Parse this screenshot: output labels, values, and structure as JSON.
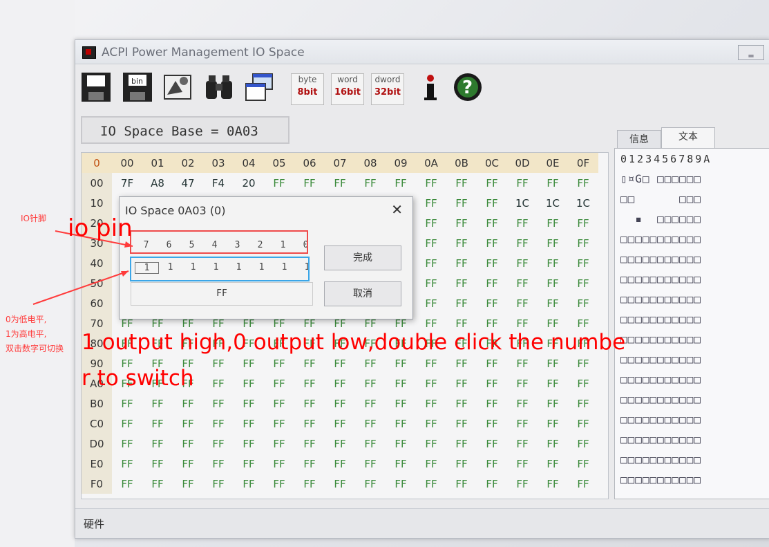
{
  "window": {
    "title": "ACPI Power Management IO Space",
    "minimize_glyph": "‗"
  },
  "toolbar": {
    "buttons": [
      {
        "name": "save-icon"
      },
      {
        "name": "save-bin-icon",
        "label": "bin"
      },
      {
        "name": "browse-icon"
      },
      {
        "name": "binoculars-icon"
      },
      {
        "name": "windows-icon"
      },
      {
        "name": "byte",
        "t1": "byte",
        "t2": "8bit"
      },
      {
        "name": "word",
        "t1": "word",
        "t2": "16bit"
      },
      {
        "name": "dword",
        "t1": "dword",
        "t2": "32bit"
      },
      {
        "name": "info-icon"
      },
      {
        "name": "help-icon"
      }
    ]
  },
  "io_base": "IO Space Base = 0A03",
  "grid": {
    "corner": "0",
    "columns": [
      "00",
      "01",
      "02",
      "03",
      "04",
      "05",
      "06",
      "07",
      "08",
      "09",
      "0A",
      "0B",
      "0C",
      "0D",
      "0E",
      "0F"
    ],
    "rows": [
      {
        "h": "00",
        "v": [
          "7F",
          "A8",
          "47",
          "F4",
          "20",
          "FF",
          "FF",
          "FF",
          "FF",
          "FF",
          "FF",
          "FF",
          "FF",
          "FF",
          "FF",
          "FF"
        ]
      },
      {
        "h": "10",
        "v": [
          "",
          "",
          "",
          "",
          "",
          "",
          "",
          "",
          "",
          "",
          "FF",
          "FF",
          "FF",
          "1C",
          "1C",
          "1C"
        ]
      },
      {
        "h": "20",
        "v": [
          "",
          "",
          "",
          "",
          "",
          "",
          "",
          "",
          "",
          "",
          "FF",
          "FF",
          "FF",
          "FF",
          "FF",
          "FF"
        ]
      },
      {
        "h": "30",
        "v": [
          "",
          "",
          "",
          "",
          "",
          "",
          "",
          "",
          "",
          "",
          "FF",
          "FF",
          "FF",
          "FF",
          "FF",
          "FF"
        ]
      },
      {
        "h": "40",
        "v": [
          "",
          "",
          "",
          "",
          "",
          "",
          "",
          "",
          "",
          "",
          "FF",
          "FF",
          "FF",
          "FF",
          "FF",
          "FF"
        ]
      },
      {
        "h": "50",
        "v": [
          "",
          "",
          "",
          "",
          "",
          "",
          "",
          "",
          "",
          "",
          "FF",
          "FF",
          "FF",
          "FF",
          "FF",
          "FF"
        ]
      },
      {
        "h": "60",
        "v": [
          "",
          "",
          "",
          "",
          "",
          "",
          "",
          "",
          "",
          "",
          "FF",
          "FF",
          "FF",
          "FF",
          "FF",
          "FF"
        ]
      },
      {
        "h": "70",
        "v": [
          "FF",
          "FF",
          "FF",
          "FF",
          "FF",
          "FF",
          "FF",
          "FF",
          "FF",
          "FF",
          "FF",
          "FF",
          "FF",
          "FF",
          "FF",
          "FF"
        ]
      },
      {
        "h": "80",
        "v": [
          "FF",
          "FF",
          "FF",
          "FF",
          "FF",
          "FF",
          "FF",
          "FF",
          "FF",
          "FF",
          "FF",
          "FF",
          "FF",
          "FF",
          "FF",
          "FF"
        ]
      },
      {
        "h": "90",
        "v": [
          "FF",
          "FF",
          "FF",
          "FF",
          "FF",
          "FF",
          "FF",
          "FF",
          "FF",
          "FF",
          "FF",
          "FF",
          "FF",
          "FF",
          "FF",
          "FF"
        ]
      },
      {
        "h": "A0",
        "v": [
          "FF",
          "FF",
          "FF",
          "FF",
          "FF",
          "FF",
          "FF",
          "FF",
          "FF",
          "FF",
          "FF",
          "FF",
          "FF",
          "FF",
          "FF",
          "FF"
        ]
      },
      {
        "h": "B0",
        "v": [
          "FF",
          "FF",
          "FF",
          "FF",
          "FF",
          "FF",
          "FF",
          "FF",
          "FF",
          "FF",
          "FF",
          "FF",
          "FF",
          "FF",
          "FF",
          "FF"
        ]
      },
      {
        "h": "C0",
        "v": [
          "FF",
          "FF",
          "FF",
          "FF",
          "FF",
          "FF",
          "FF",
          "FF",
          "FF",
          "FF",
          "FF",
          "FF",
          "FF",
          "FF",
          "FF",
          "FF"
        ]
      },
      {
        "h": "D0",
        "v": [
          "FF",
          "FF",
          "FF",
          "FF",
          "FF",
          "FF",
          "FF",
          "FF",
          "FF",
          "FF",
          "FF",
          "FF",
          "FF",
          "FF",
          "FF",
          "FF"
        ]
      },
      {
        "h": "E0",
        "v": [
          "FF",
          "FF",
          "FF",
          "FF",
          "FF",
          "FF",
          "FF",
          "FF",
          "FF",
          "FF",
          "FF",
          "FF",
          "FF",
          "FF",
          "FF",
          "FF"
        ]
      },
      {
        "h": "F0",
        "v": [
          "FF",
          "FF",
          "FF",
          "FF",
          "FF",
          "FF",
          "FF",
          "FF",
          "FF",
          "FF",
          "FF",
          "FF",
          "FF",
          "FF",
          "FF",
          "FF"
        ]
      }
    ]
  },
  "right_panel": {
    "tabs": [
      "信息",
      "文本"
    ],
    "ruler": "0123456789A",
    "rows": [
      "▯¤G□ □□□□□□",
      "□□      □□□",
      "  ▪  □□□□□□",
      "□□□□□□□□□□□",
      "□□□□□□□□□□□",
      "□□□□□□□□□□□",
      "□□□□□□□□□□□",
      "□□□□□□□□□□□",
      "□□□□□□□□□□□",
      "□□□□□□□□□□□",
      "□□□□□□□□□□□",
      "□□□□□□□□□□□",
      "□□□□□□□□□□□",
      "□□□□□□□□□□□",
      "□□□□□□□□□□□",
      "□□□□□□□□□□□"
    ]
  },
  "status": "硬件",
  "dialog": {
    "title": "IO Space 0A03 (0)",
    "close": "✕",
    "bit_labels": [
      "7",
      "6",
      "5",
      "4",
      "3",
      "2",
      "1",
      "0"
    ],
    "bit_values": [
      "1",
      "1",
      "1",
      "1",
      "1",
      "1",
      "1",
      "1"
    ],
    "hex_value": "FF",
    "ok": "完成",
    "cancel": "取消"
  },
  "annotations": {
    "io_pin_cn": "IO针脚",
    "io_pin_en": "io pin",
    "left_cn": [
      "0为低电平,",
      "1为高电平,",
      "双击数字可切换"
    ],
    "desc_line1": "1 output high,0 output low,double click the numbe",
    "desc_line2": "r to switch",
    "red": "#ff0000",
    "blue": "#3aa6e8"
  }
}
